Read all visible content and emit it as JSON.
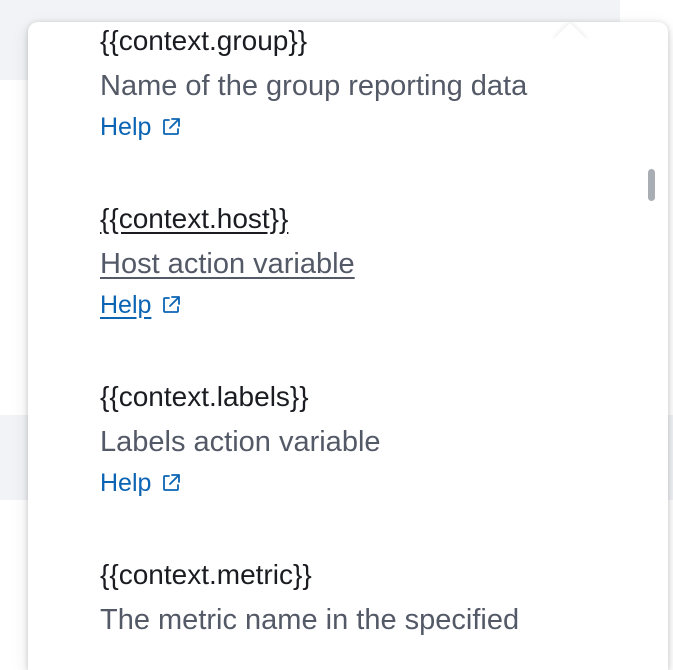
{
  "variables": [
    {
      "name": "{{context.group}}",
      "description": "Name of the group reporting data",
      "help_label": "Help"
    },
    {
      "name": "{{context.host}}",
      "description": "Host action variable",
      "help_label": "Help"
    },
    {
      "name": "{{context.labels}}",
      "description": "Labels action variable",
      "help_label": "Help"
    },
    {
      "name": "{{context.metric}}",
      "description": "The metric name in the specified",
      "help_label": ""
    }
  ],
  "colors": {
    "link": "#0b64b4",
    "name_text": "#1a1c21",
    "description_text": "#535966",
    "popover_bg": "#ffffff",
    "scrollbar": "#a9adb4"
  },
  "icons": {
    "help_link_icon": "external-link-icon"
  }
}
